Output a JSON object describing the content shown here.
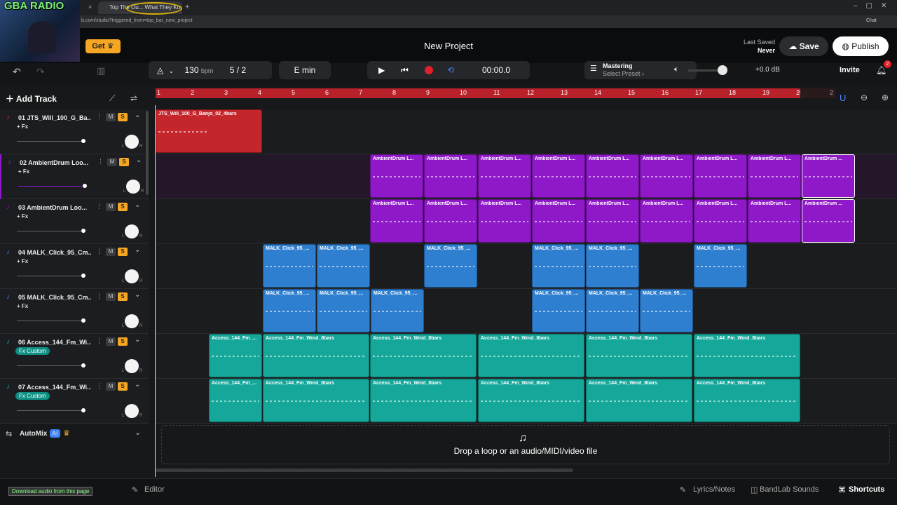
{
  "browser": {
    "tab_title": "Top The Ou... What They Ko...",
    "url": "b.com/studio?triggered_from=top_bar_new_project",
    "chat": "Chat"
  },
  "overlay": {
    "logo_text": "GBA RADIO",
    "download_label": "Download audio from this page"
  },
  "header": {
    "get_label": "Get",
    "title": "New Project",
    "last_saved_label": "Last Saved",
    "last_saved_value": "Never",
    "save_label": "Save",
    "publish_label": "Publish"
  },
  "toolbar": {
    "bpm": "130",
    "bpm_unit": "bpm",
    "time_sig": "5 / 2",
    "key": "E min",
    "time": "00:00.0",
    "mastering_label": "Mastering",
    "mastering_preset": "Select Preset ›",
    "gain": "+0.0 dB",
    "invite_label": "Invite",
    "notification_count": "2"
  },
  "ruler": {
    "ticks": [
      "1",
      "2",
      "3",
      "4",
      "5",
      "6",
      "7",
      "8",
      "9",
      "10",
      "11",
      "12",
      "13",
      "14",
      "15",
      "16",
      "17",
      "18",
      "19",
      "20",
      "2"
    ]
  },
  "left_panel": {
    "add_track_label": "Add Track",
    "automix_label": "AutoMix",
    "ai_badge": "AI"
  },
  "tracks": [
    {
      "name": "01  JTS_Will_100_G_Ba...",
      "fx": "+ Fx",
      "color": "#d9262c",
      "icon": "mic-icon"
    },
    {
      "name": "02  AmbientDrum Loo...",
      "fx": "+ Fx",
      "color": "#8f18c9",
      "icon": "mic-icon"
    },
    {
      "name": "03  AmbientDrum Loo...",
      "fx": "+ Fx",
      "color": "#8f18c9",
      "icon": "mic-icon"
    },
    {
      "name": "04  MALK_Click_95_Cm...",
      "fx": "+ Fx",
      "color": "#2f7fd0",
      "icon": "mic-icon"
    },
    {
      "name": "05  MALK_Click_95_Cm...",
      "fx": "+ Fx",
      "color": "#2f7fd0",
      "icon": "mic-icon"
    },
    {
      "name": "06  Access_144_Fm_Wi...",
      "fx": "Fx Custom",
      "color": "#15a89a",
      "icon": "mic-icon"
    },
    {
      "name": "07  Access_144_Fm_Wi...",
      "fx": "Fx Custom",
      "color": "#15a89a",
      "icon": "mic-icon"
    }
  ],
  "track_controls": {
    "mute": "M",
    "solo": "S",
    "l": "L",
    "r": "R"
  },
  "clip_labels": {
    "c1": "JTS_Will_100_G_Banjo_02_4bars",
    "amb": "AmbientDrum L...",
    "amb_last": "AmbientDrum ...",
    "malk": "MALK_Click_95_...",
    "acc_short": "Access_144_Fm_...",
    "acc": "Access_144_Fm_Wind_8bars"
  },
  "drop_zone": {
    "text": "Drop a loop or an audio/MIDI/video file"
  },
  "bottom": {
    "editor_label": "Editor",
    "lyrics_label": "Lyrics/Notes",
    "bandlab_label": "BandLab Sounds",
    "shortcuts_label": "Shortcuts"
  }
}
